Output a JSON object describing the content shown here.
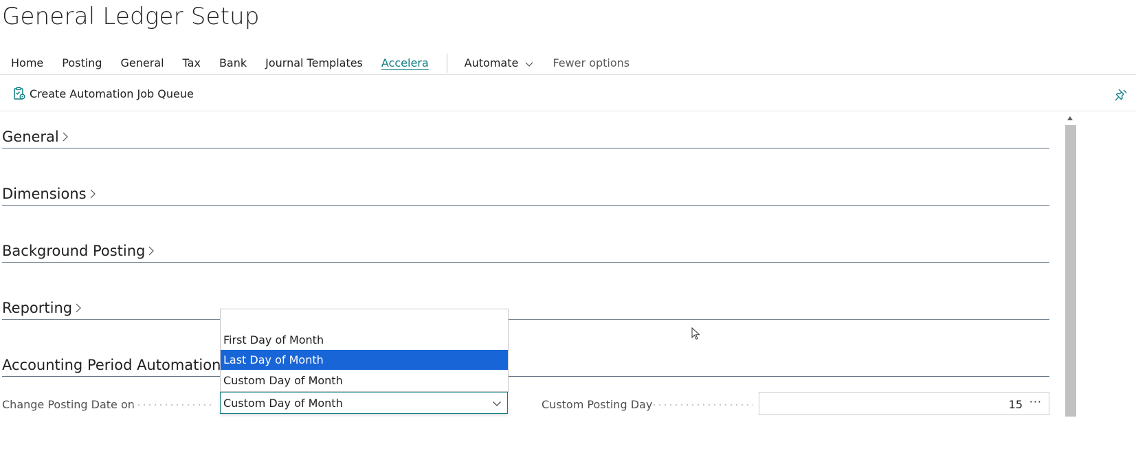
{
  "page": {
    "title": "General Ledger Setup"
  },
  "nav": {
    "items": [
      {
        "label": "Home"
      },
      {
        "label": "Posting"
      },
      {
        "label": "General"
      },
      {
        "label": "Tax"
      },
      {
        "label": "Bank"
      },
      {
        "label": "Journal Templates"
      },
      {
        "label": "Accelera",
        "active": true
      }
    ],
    "automate_label": "Automate",
    "fewer_options_label": "Fewer options"
  },
  "actions": {
    "create_job_queue_label": "Create Automation Job Queue"
  },
  "sections": {
    "general": "General",
    "dimensions": "Dimensions",
    "background_posting": "Background Posting",
    "reporting": "Reporting",
    "accounting_period_automation": "Accounting Period Automation"
  },
  "fields": {
    "change_posting_date_on": {
      "label": "Change Posting Date on",
      "value": "Custom Day of Month"
    },
    "custom_posting_day": {
      "label": "Custom Posting Day",
      "value": "15",
      "more_label": "···"
    }
  },
  "dropdown": {
    "options": [
      {
        "label": ""
      },
      {
        "label": "First Day of Month"
      },
      {
        "label": "Last Day of Month",
        "selected": true
      },
      {
        "label": "Custom Day of Month"
      }
    ]
  },
  "colors": {
    "accent": "#0c7d83",
    "selection": "#1865d8",
    "section_rule": "#5a6a7a"
  }
}
